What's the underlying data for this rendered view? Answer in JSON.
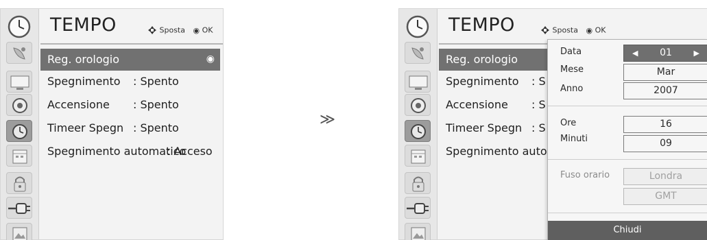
{
  "arrow_glyph": "≫",
  "left": {
    "title": "TEMPO",
    "hints": {
      "move_label": "Sposta",
      "ok_label": "OK"
    },
    "menu": [
      {
        "label": "Reg. orologio",
        "value": "",
        "selected": true
      },
      {
        "label": "Spegnimento",
        "value": ": Spento"
      },
      {
        "label": "Accensione",
        "value": ": Spento"
      },
      {
        "label": "Timeer Spegn",
        "value": ": Spento"
      },
      {
        "label": "Spegnimento automatico",
        "value": ": Acceso"
      }
    ],
    "sidebar_icons": [
      "clock-icon",
      "satellite-dish-icon",
      "tv-screen-icon",
      "speaker-icon",
      "clock-small-icon",
      "calendar-icon",
      "lock-icon",
      "input-plug-icon",
      "photo-icon"
    ]
  },
  "right": {
    "title": "TEMPO",
    "hints": {
      "move_label": "Sposta",
      "ok_label": "OK"
    },
    "menu": [
      {
        "label": "Reg. orologio",
        "value": ""
      },
      {
        "label": "Spegnimento",
        "value": ": S"
      },
      {
        "label": "Accensione",
        "value": ": S"
      },
      {
        "label": "Timeer Spegn",
        "value": ": S"
      },
      {
        "label": "Spegnimento automat",
        "value": ""
      }
    ],
    "popup": {
      "date": {
        "label": "Data",
        "value": "01"
      },
      "month": {
        "label": "Mese",
        "value": "Mar"
      },
      "year": {
        "label": "Anno",
        "value": "2007"
      },
      "hour": {
        "label": "Ore",
        "value": "16"
      },
      "minutes": {
        "label": "Minuti",
        "value": "09"
      },
      "timezone": {
        "label": "Fuso orario",
        "value": "Londra",
        "sub_value": "GMT"
      },
      "close_label": "Chiudi"
    }
  },
  "colors": {
    "selected_row": "#717171",
    "panel_bg": "#f3f3f3",
    "active_field": "#6f6f6f"
  }
}
